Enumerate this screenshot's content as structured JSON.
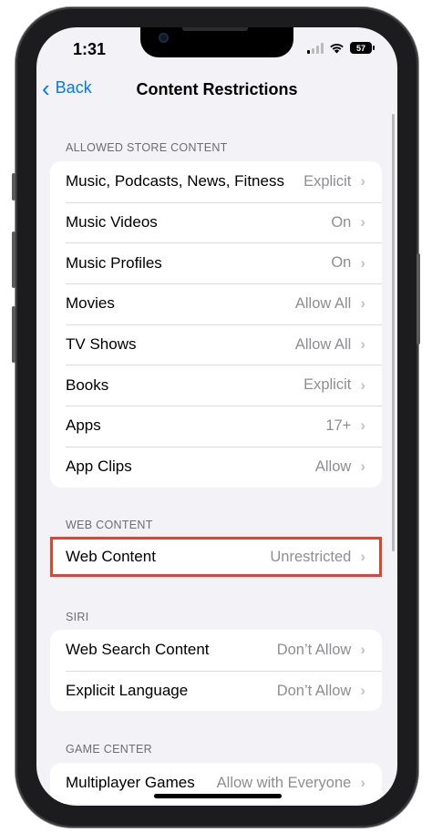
{
  "status": {
    "time": "1:31",
    "battery": "57"
  },
  "nav": {
    "back_label": "Back",
    "title": "Content Restrictions"
  },
  "sections": {
    "store": {
      "header": "ALLOWED STORE CONTENT",
      "rows": [
        {
          "label": "Music, Podcasts, News, Fitness",
          "value": "Explicit"
        },
        {
          "label": "Music Videos",
          "value": "On"
        },
        {
          "label": "Music Profiles",
          "value": "On"
        },
        {
          "label": "Movies",
          "value": "Allow All"
        },
        {
          "label": "TV Shows",
          "value": "Allow All"
        },
        {
          "label": "Books",
          "value": "Explicit"
        },
        {
          "label": "Apps",
          "value": "17+"
        },
        {
          "label": "App Clips",
          "value": "Allow"
        }
      ]
    },
    "web": {
      "header": "WEB CONTENT",
      "rows": [
        {
          "label": "Web Content",
          "value": "Unrestricted"
        }
      ]
    },
    "siri": {
      "header": "SIRI",
      "rows": [
        {
          "label": "Web Search Content",
          "value": "Don’t Allow"
        },
        {
          "label": "Explicit Language",
          "value": "Don’t Allow"
        }
      ]
    },
    "game": {
      "header": "GAME CENTER",
      "rows": [
        {
          "label": "Multiplayer Games",
          "value": "Allow with Everyone"
        }
      ]
    }
  },
  "colors": {
    "accent": "#007aff",
    "highlight": "#e1442e",
    "background": "#f2f2f7"
  }
}
